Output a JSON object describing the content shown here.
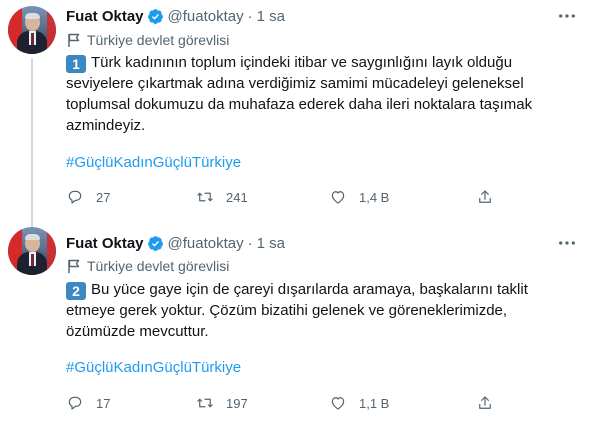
{
  "tweets": [
    {
      "author": "Fuat Oktay",
      "handle": "@fuatoktay",
      "separator": "·",
      "time": "1 sa",
      "label": "Türkiye devlet görevlisi",
      "number_emoji": "1",
      "text": "Türk kadınının toplum içindeki itibar ve saygınlığını layık olduğu seviyelere çıkartmak adına verdiğimiz samimi mücadeleyi geleneksel toplumsal dokumuzu da muhafaza ederek daha ileri noktalara taşımak azmindeyiz.",
      "hashtag": "#GüçlüKadınGüçlüTürkiye",
      "replies": "27",
      "retweets": "241",
      "likes": "1,4 B"
    },
    {
      "author": "Fuat Oktay",
      "handle": "@fuatoktay",
      "separator": "·",
      "time": "1 sa",
      "label": "Türkiye devlet görevlisi",
      "number_emoji": "2",
      "text": "Bu yüce gaye için de çareyi dışarılarda aramaya, başkalarını taklit etmeye gerek yoktur. Çözüm bizatihi gelenek ve göreneklerimizde, özümüzde mevcuttur.",
      "hashtag": "#GüçlüKadınGüçlüTürkiye",
      "replies": "17",
      "retweets": "197",
      "likes": "1,1 B"
    }
  ],
  "colors": {
    "verified": "#1d9bf0",
    "hashtag": "#1d9bf0",
    "muted": "#536471",
    "thread_line": "#cfd9de"
  },
  "icons": [
    "verified-badge-icon",
    "more-options-icon",
    "government-flag-icon",
    "reply-icon",
    "retweet-icon",
    "like-icon",
    "share-icon"
  ]
}
